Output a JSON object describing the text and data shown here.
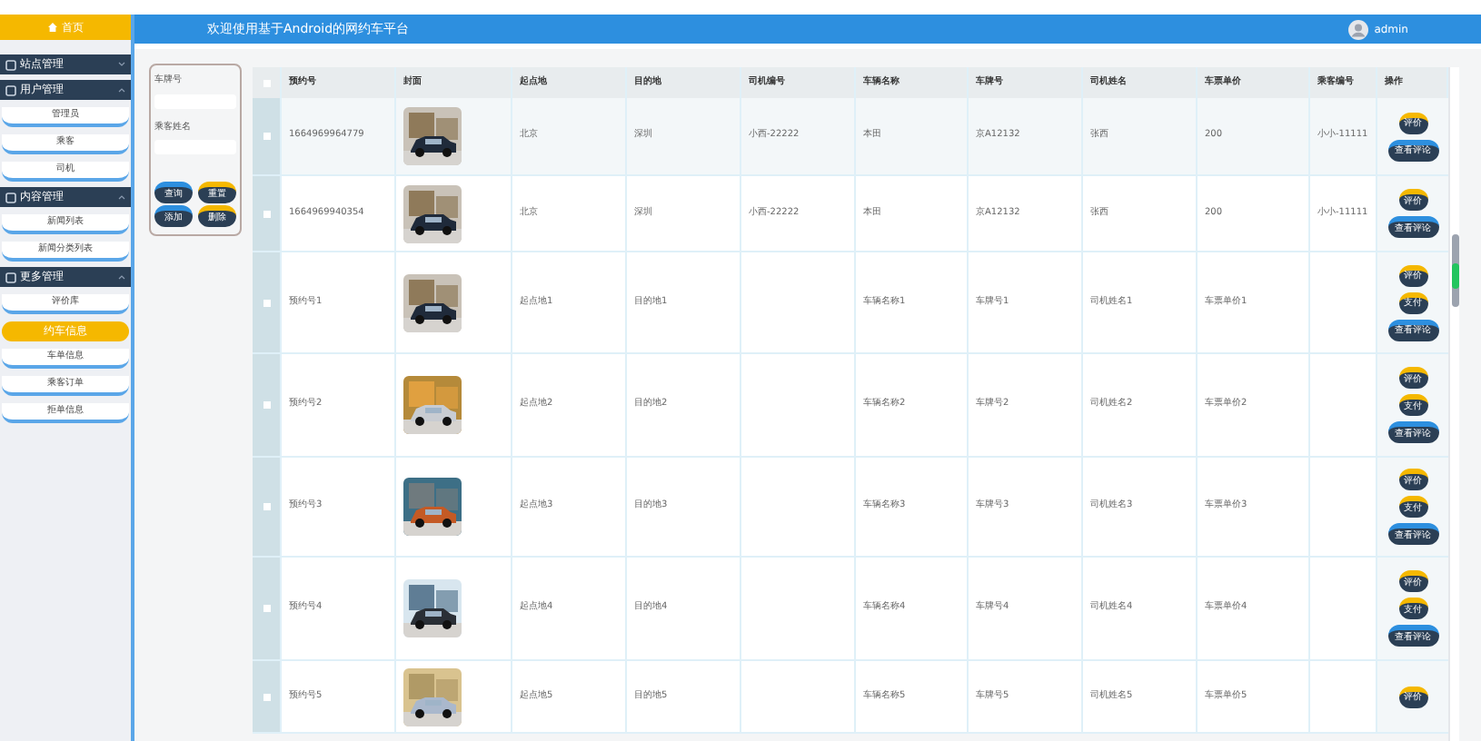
{
  "sidebar": {
    "home": "首页",
    "groups": [
      {
        "label": "站点管理",
        "expanded": false
      },
      {
        "label": "用户管理",
        "expanded": true,
        "items": [
          {
            "label": "管理员",
            "selected": false
          },
          {
            "label": "乘客",
            "selected": false
          },
          {
            "label": "司机",
            "selected": false
          }
        ]
      },
      {
        "label": "内容管理",
        "expanded": true,
        "items": [
          {
            "label": "新闻列表",
            "selected": false
          },
          {
            "label": "新闻分类列表",
            "selected": false
          }
        ]
      },
      {
        "label": "更多管理",
        "expanded": true,
        "items": [
          {
            "label": "评价库",
            "selected": false
          },
          {
            "label": "约车信息",
            "selected": true
          },
          {
            "label": "车单信息",
            "selected": false
          },
          {
            "label": "乘客订单",
            "selected": false
          },
          {
            "label": "拒单信息",
            "selected": false
          }
        ]
      }
    ]
  },
  "header": {
    "title": "欢迎使用基于Android的网约车平台",
    "user": "admin"
  },
  "search": {
    "fields": [
      {
        "label": "车牌号"
      },
      {
        "label": "乘客姓名"
      }
    ],
    "buttons": [
      {
        "label": "查询",
        "kind": "blue"
      },
      {
        "label": "重置",
        "kind": "yellow"
      },
      {
        "label": "添加",
        "kind": "blue"
      },
      {
        "label": "删除",
        "kind": "yellow"
      }
    ]
  },
  "table": {
    "all_checked": false,
    "columns": [
      "预约号",
      "封面",
      "起点地",
      "目的地",
      "司机编号",
      "车辆名称",
      "车牌号",
      "司机姓名",
      "车票单价",
      "乘客编号",
      "操作"
    ],
    "rows": [
      {
        "checked": false,
        "cells": [
          "1664969964779",
          "",
          "北京",
          "深圳",
          "小西-22222",
          "本田",
          "京A12132",
          "张西",
          "200",
          "小小-11111"
        ],
        "actions": [
          "评价",
          "查看评论"
        ]
      },
      {
        "checked": false,
        "cells": [
          "1664969940354",
          "",
          "北京",
          "深圳",
          "小西-22222",
          "本田",
          "京A12132",
          "张西",
          "200",
          "小小-11111"
        ],
        "actions": [
          "评价",
          "查看评论"
        ]
      },
      {
        "checked": false,
        "cells": [
          "预约号1",
          "",
          "起点地1",
          "目的地1",
          "",
          "车辆名称1",
          "车牌号1",
          "司机姓名1",
          "车票单价1",
          ""
        ],
        "actions": [
          "评价",
          "支付",
          "查看评论"
        ]
      },
      {
        "checked": false,
        "cells": [
          "预约号2",
          "",
          "起点地2",
          "目的地2",
          "",
          "车辆名称2",
          "车牌号2",
          "司机姓名2",
          "车票单价2",
          ""
        ],
        "actions": [
          "评价",
          "支付",
          "查看评论"
        ]
      },
      {
        "checked": false,
        "cells": [
          "预约号3",
          "",
          "起点地3",
          "目的地3",
          "",
          "车辆名称3",
          "车牌号3",
          "司机姓名3",
          "车票单价3",
          ""
        ],
        "actions": [
          "评价",
          "支付",
          "查看评论"
        ]
      },
      {
        "checked": false,
        "cells": [
          "预约号4",
          "",
          "起点地4",
          "目的地4",
          "",
          "车辆名称4",
          "车牌号4",
          "司机姓名4",
          "车票单价4",
          ""
        ],
        "actions": [
          "评价",
          "支付",
          "查看评论"
        ]
      },
      {
        "checked": false,
        "cells": [
          "预约号5",
          "",
          "起点地5",
          "目的地5",
          "",
          "车辆名称5",
          "车牌号5",
          "司机姓名5",
          "车票单价5",
          ""
        ],
        "actions": [
          "评价"
        ]
      }
    ]
  }
}
